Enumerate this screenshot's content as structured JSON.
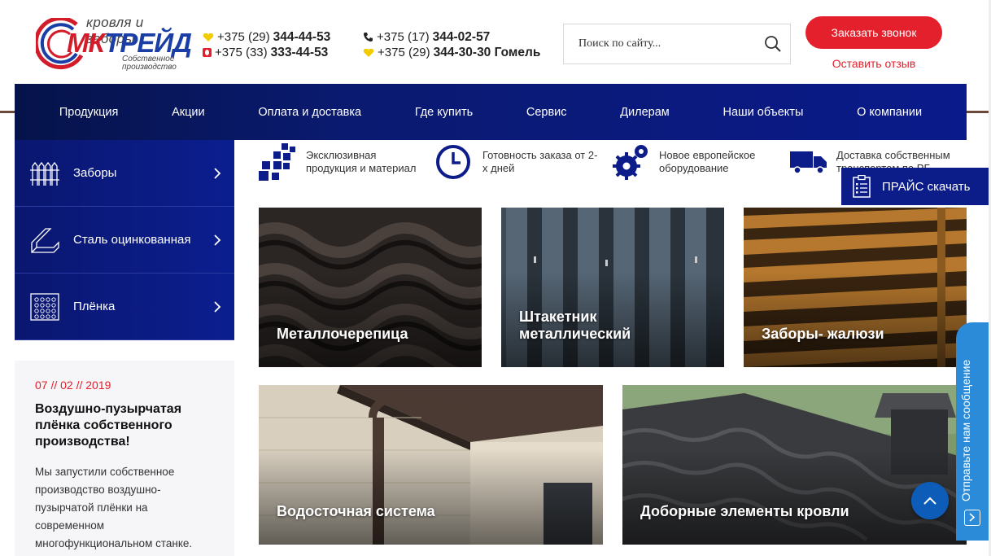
{
  "header": {
    "logo": {
      "tagline": "кровля и заборы",
      "brand_mk": "МК",
      "brand_rest": "ТРЕЙД",
      "sub": "Собственное производство"
    },
    "phones_left": [
      {
        "icon": "velcom-heart-icon",
        "prefix": "+375 (29)",
        "number": "344-44-53"
      },
      {
        "icon": "mts-icon",
        "prefix": "+375 (33)",
        "number": "333-44-53"
      }
    ],
    "phones_right": [
      {
        "icon": "phone-icon",
        "prefix": "+375 (17)",
        "number": "344-02-57"
      },
      {
        "icon": "velcom-heart-icon",
        "prefix": "+375 (29)",
        "number": "344-30-30 Гомель"
      }
    ],
    "search": {
      "placeholder": "Поиск по сайту..."
    },
    "call_button": "Заказать звонок",
    "review_link": "Оставить отзыв"
  },
  "nav": [
    "Продукция",
    "Акции",
    "Оплата и доставка",
    "Где купить",
    "Сервис",
    "Дилерам",
    "Наши объекты",
    "О компании"
  ],
  "sidebar": [
    {
      "label": "Заборы",
      "icon": "fence-icon"
    },
    {
      "label": "Сталь оцинкованная",
      "icon": "steel-angle-icon"
    },
    {
      "label": "Плёнка",
      "icon": "film-icon"
    }
  ],
  "news": {
    "date": "07 // 02 // 2019",
    "title": "Воздушно-пузырчатая плёнка собственного производства!",
    "text": "Мы запустили собственное производство воздушно-пузырчатой плёнки на современном многофункциональном станке."
  },
  "features": [
    {
      "text": "Эксклюзивная продукция и материал",
      "icon": "squares-icon"
    },
    {
      "text": "Готовность заказа от 2-х дней",
      "icon": "clock-icon"
    },
    {
      "text": "Новое европейское оборудование",
      "icon": "gears-icon"
    },
    {
      "text": "Доставка собственным транспортом по РБ",
      "icon": "truck-icon"
    }
  ],
  "price_button": "ПРАЙС скачать",
  "tiles": [
    {
      "label": "Металлочерепица"
    },
    {
      "label": "Штакетник металлический"
    },
    {
      "label": "Заборы- жалюзи"
    },
    {
      "label": "Водосточная система"
    },
    {
      "label": "Доборные элементы кровли"
    }
  ],
  "feedback_tab": "Отправьте нам сообщение",
  "colors": {
    "accent_red": "#e4202c",
    "nav_blue": "#0a1a8a",
    "feedback_blue": "#2c8bd8"
  }
}
